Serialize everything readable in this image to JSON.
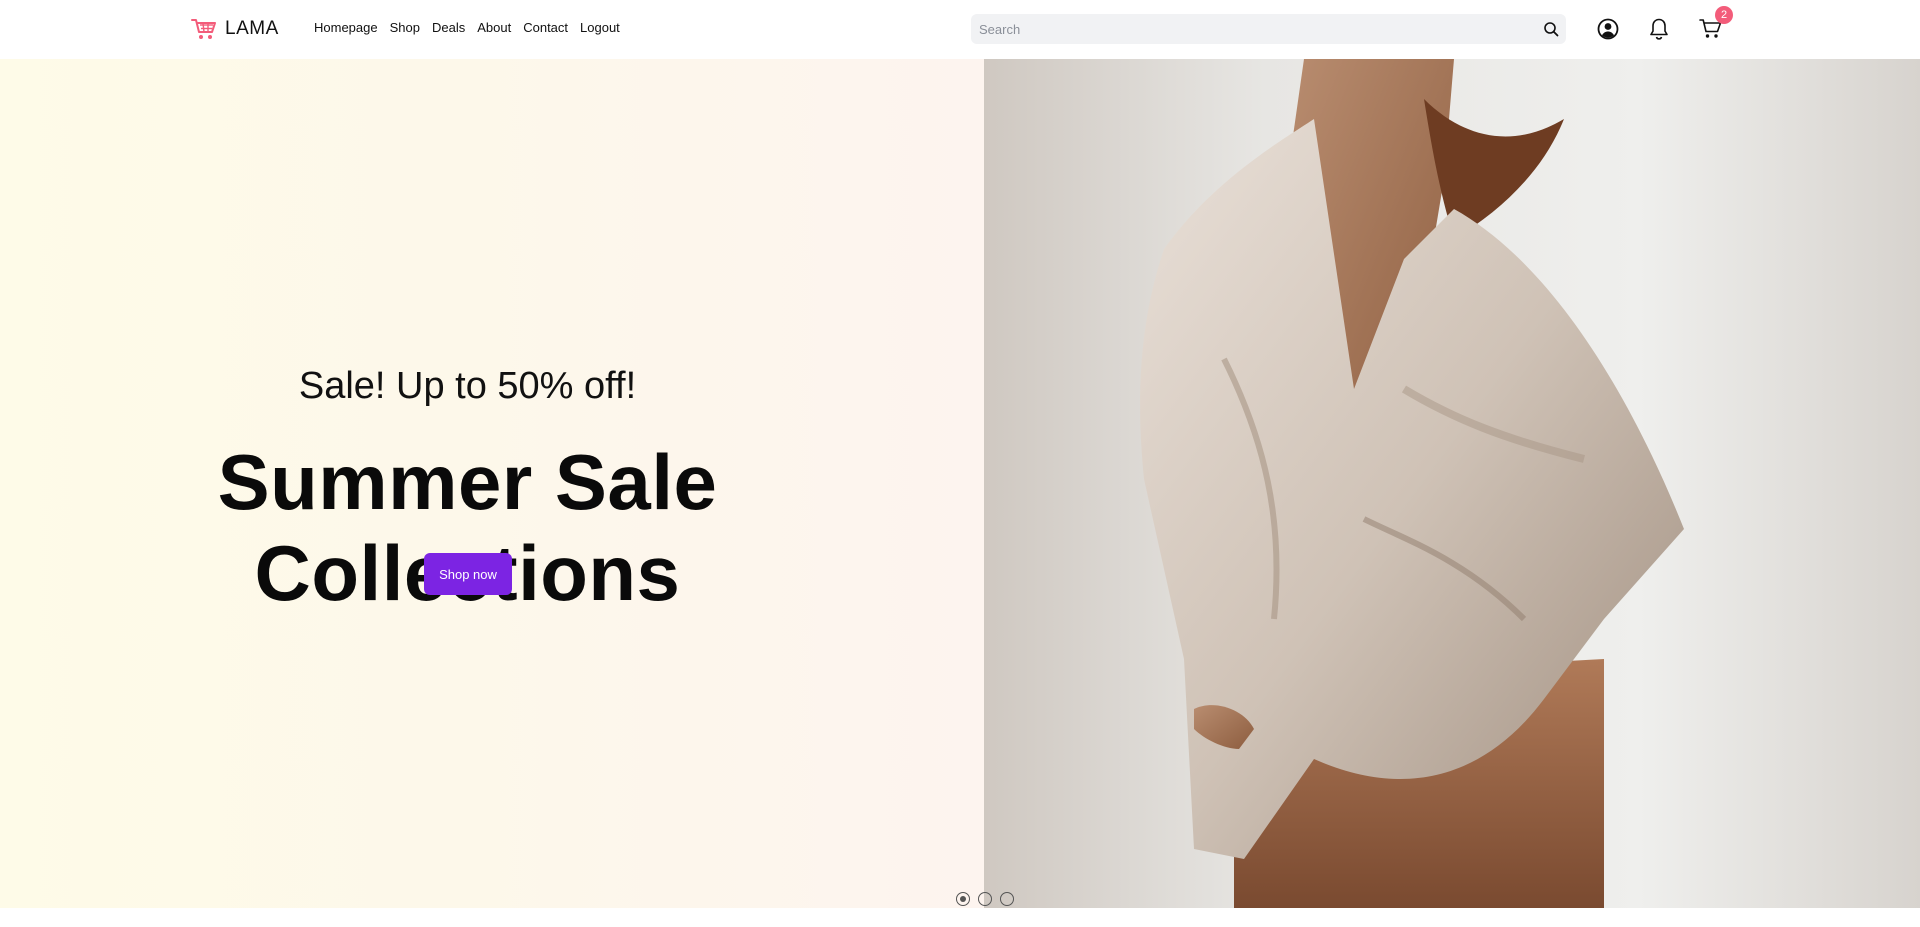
{
  "header": {
    "brand": "LAMA",
    "nav": [
      {
        "label": "Homepage"
      },
      {
        "label": "Shop"
      },
      {
        "label": "Deals"
      },
      {
        "label": "About"
      },
      {
        "label": "Contact"
      },
      {
        "label": "Logout"
      }
    ],
    "search": {
      "placeholder": "Search",
      "value": ""
    },
    "icons": [
      "cart-logo-icon",
      "search-icon",
      "profile-icon",
      "notification-bell-icon",
      "cart-icon"
    ],
    "cart_count": "2"
  },
  "hero": {
    "subtitle": "Sale! Up to 50% off!",
    "title": "Summer Sale Collections",
    "button": "Shop now",
    "slides": [
      {
        "active": true
      },
      {
        "active": false
      },
      {
        "active": false
      }
    ]
  },
  "colors": {
    "accent": "#7c24e3",
    "badge": "#f35c7a",
    "logo": "#f35c7a"
  }
}
